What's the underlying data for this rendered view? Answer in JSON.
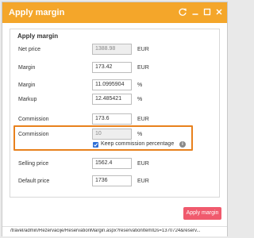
{
  "window": {
    "title": "Apply margin",
    "icons": [
      "refresh-icon",
      "minimize-icon",
      "maximize-icon",
      "close-icon"
    ],
    "titlebar_color": "#f4a62a"
  },
  "panel": {
    "title": "Apply margin",
    "fields": {
      "net_price": {
        "label": "Net price",
        "value": "1388.98",
        "unit": "EUR"
      },
      "margin_amount": {
        "label": "Margin",
        "value": "173.42",
        "unit": "EUR"
      },
      "margin_percent": {
        "label": "Margin",
        "value": "11.0995904",
        "unit": "%"
      },
      "markup": {
        "label": "Markup",
        "value": "12.485421",
        "unit": "%"
      },
      "commission_amount": {
        "label": "Commission",
        "value": "173.6",
        "unit": "EUR"
      },
      "commission_percent": {
        "label": "Commission",
        "value": "10",
        "unit": "%"
      },
      "selling_price": {
        "label": "Selling price",
        "value": "1562.4",
        "unit": "EUR"
      },
      "default_price": {
        "label": "Default price",
        "value": "1736",
        "unit": "EUR"
      }
    },
    "keep_commission": {
      "label": "Keep commission percentage",
      "checked": true
    },
    "highlight_color": "#e8811d"
  },
  "actions": {
    "apply_label": "Apply margin",
    "apply_color": "#f05a6d"
  },
  "status": {
    "url": "/travel/admin/Rezervacije/ReservationMargin.aspx?reservationItemIDs=1370724&reserv..."
  }
}
